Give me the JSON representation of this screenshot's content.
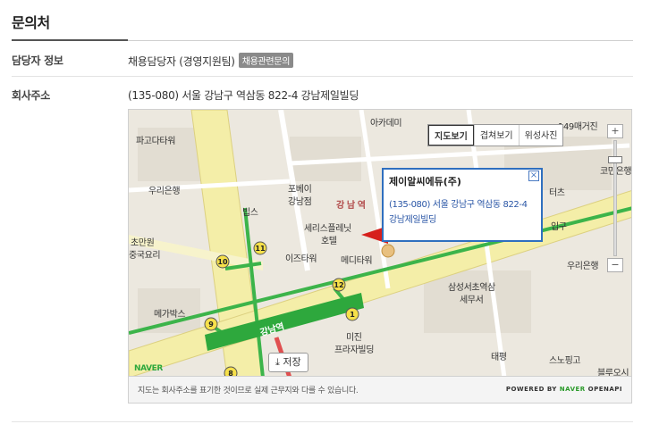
{
  "section": {
    "title": "문의처"
  },
  "contact": {
    "label": "담당자 정보",
    "value": "채용담당자 (경영지원팀)",
    "badge": "채용관련문의"
  },
  "address": {
    "label": "회사주소",
    "value": "(135-080) 서울 강남구 역삼동 822-4 강남제일빌딩"
  },
  "map": {
    "tabs": [
      "지도보기",
      "겹쳐보기",
      "위성사진"
    ],
    "zoom_in": "+",
    "zoom_out": "−",
    "info": {
      "title": "제이알씨에듀(주)",
      "address": "(135-080) 서울 강남구 역삼동 822-4 강남제일빌딩"
    },
    "save_label": "저장",
    "footnote": "지도는 회사주소를 표기한 것이므로 실제 근무지와 다를 수 있습니다.",
    "powered_prefix": "POWERED BY",
    "powered_brand": "NAVER",
    "powered_suffix": "OPENAPI",
    "places": {
      "p1": "파고다타워",
      "p2": "우리은행",
      "p3": "초만원",
      "p4": "중국요리",
      "p5": "메가박스",
      "p6": "빕스",
      "p7": "포베이",
      "p8": "강남점",
      "p9": "강 남 역",
      "p10": "세리스플레닛",
      "p11": "호텔",
      "p12": "이즈타워",
      "p13": "메디타워",
      "p14": "삼성서초역삼",
      "p15": "세무서",
      "p16": "미진",
      "p17": "프라자빌딩",
      "p18": "태평",
      "p19": "스노핑고",
      "p20": "우리은행",
      "p21": "블루오시",
      "p22": "아카데미",
      "p23": "149매거진",
      "p24": "터츠",
      "p25": "입구",
      "p26": "코민은행",
      "p27": "강남역",
      "p28": "NAVER"
    },
    "exits": [
      "10",
      "11",
      "12",
      "1",
      "9",
      "8"
    ]
  }
}
